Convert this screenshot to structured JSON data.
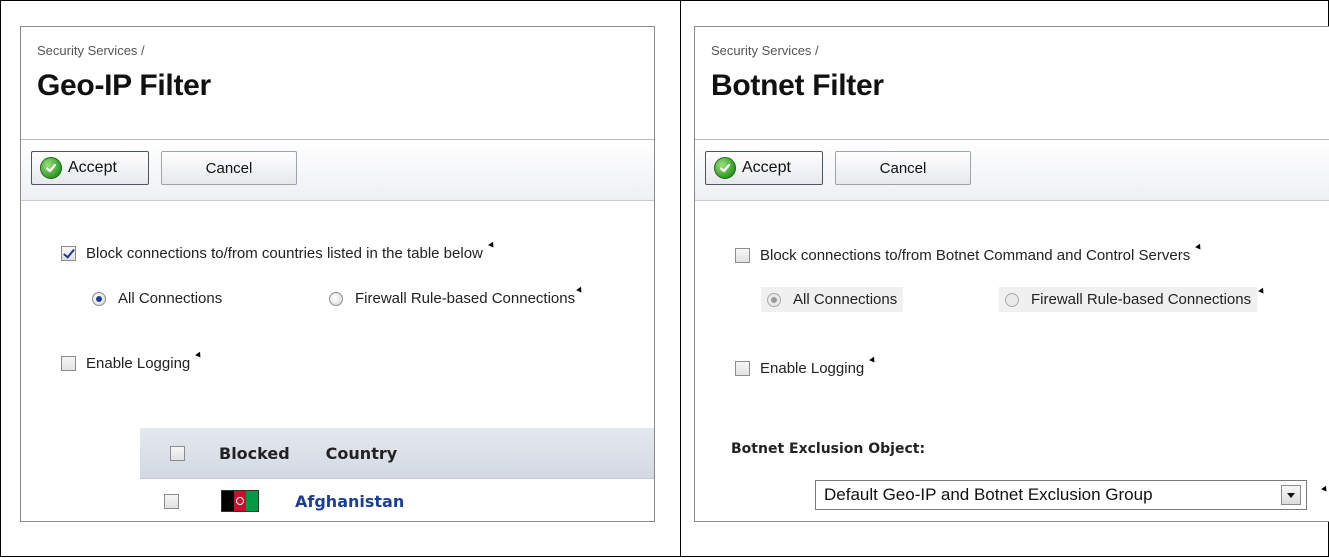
{
  "panels": {
    "geo": {
      "breadcrumb": "Security Services /",
      "title": "Geo-IP Filter",
      "accept_label": "Accept",
      "cancel_label": "Cancel",
      "block_label": "Block connections to/from countries listed in the table below",
      "block_checked": true,
      "radio_all": "All Connections",
      "radio_firewall": "Firewall Rule-based Connections",
      "selected_radio": "all",
      "logging_label": "Enable Logging",
      "logging_checked": false,
      "table": {
        "columns": [
          "Blocked",
          "Country"
        ],
        "rows": [
          {
            "country": "Afghanistan",
            "blocked": false
          }
        ]
      }
    },
    "botnet": {
      "breadcrumb": "Security Services /",
      "title": "Botnet Filter",
      "accept_label": "Accept",
      "cancel_label": "Cancel",
      "block_label": "Block connections to/from Botnet Command and Control Servers",
      "block_checked": false,
      "radio_all": "All Connections",
      "radio_firewall": "Firewall Rule-based Connections",
      "selected_radio": "all",
      "logging_label": "Enable Logging",
      "logging_checked": false,
      "exclusion_label": "Botnet Exclusion Object:",
      "exclusion_value": "Default Geo-IP and Botnet Exclusion Group"
    }
  },
  "colors": {
    "link": "#1c3f95",
    "accept_icon": "#2e9a25",
    "toolbar_bg": "#eef0f3",
    "table_header_bg": "#dde2ea"
  },
  "icons": [
    "check-circle-icon",
    "info-tip-icon",
    "dropdown-arrow-icon",
    "afghanistan-flag-icon"
  ]
}
